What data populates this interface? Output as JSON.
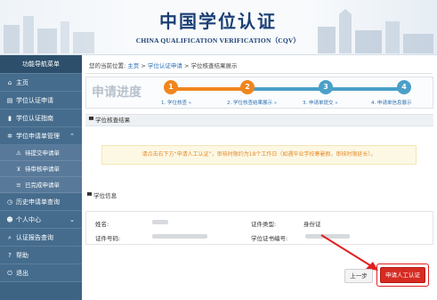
{
  "header": {
    "title_cn": "中国学位认证",
    "title_en": "CHINA QUALIFICATION VERIFICATION（CQV）"
  },
  "sidebar": {
    "title": "功能导航菜单",
    "items": [
      {
        "label": "主页",
        "icon": "home-icon"
      },
      {
        "label": "学位认证申请",
        "icon": "document-icon"
      },
      {
        "label": "学位认证指南",
        "icon": "book-icon"
      },
      {
        "label": "学位申请单管理",
        "icon": "gear-icon",
        "expanded": true,
        "children": [
          {
            "label": "待提交申请单",
            "icon": "warning-icon"
          },
          {
            "label": "待审核申请单",
            "icon": "cart-icon"
          },
          {
            "label": "已完成申请单",
            "icon": "stack-icon"
          }
        ]
      },
      {
        "label": "历史申请单查询",
        "icon": "history-icon"
      },
      {
        "label": "个人中心",
        "icon": "user-icon",
        "expanded": false
      },
      {
        "label": "认证报告查询",
        "icon": "search-icon"
      },
      {
        "label": "帮助",
        "icon": "help-icon"
      },
      {
        "label": "退出",
        "icon": "power-icon"
      }
    ]
  },
  "breadcrumb": {
    "prefix": "您的当前位置:",
    "home": "主页",
    "sep1": " > ",
    "level1": "学位认证申请",
    "sep2": " > ",
    "current": "学位核查结果展示"
  },
  "progress": {
    "title": "申请进度",
    "steps": [
      {
        "number": "1",
        "label": "1. 学位核查 »",
        "state": "done"
      },
      {
        "number": "2",
        "label": "2. 学位核查结果展示 »",
        "state": "current"
      },
      {
        "number": "3",
        "label": "3. 申请单提交 »",
        "state": "pending"
      },
      {
        "number": "4",
        "label": "4. 申请单信息展示",
        "state": "pending"
      }
    ]
  },
  "result": {
    "section_title": "学位核查结果",
    "notice": "请点击右下方“申请人工认证”，审核时限约为18个工作日（如遇毕业学校寒暑假，审核时限延长）。"
  },
  "degree_info": {
    "title": "学位信息",
    "name_label": "姓名:",
    "id_label": "证件号码:",
    "id_type_label": "证件类型:",
    "id_type_value": "身份证",
    "cert_no_label": "学位证书编号:"
  },
  "actions": {
    "prev_label": "上一步",
    "apply_label": "申请人工认证"
  },
  "colors": {
    "sidebar_bg": "#3e6484",
    "step_done": "#f0861e",
    "step_pending": "#4aa0c8",
    "notice_text": "#e28a2c",
    "apply_button": "#d52b23"
  }
}
